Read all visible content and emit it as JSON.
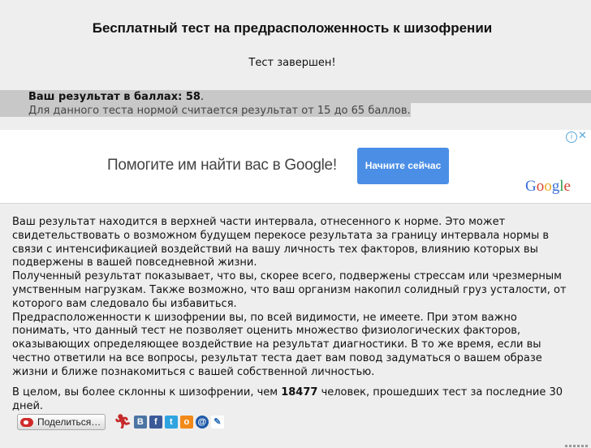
{
  "header": {
    "title": "Бесплатный тест на предрасположенность к шизофрении",
    "status": "Тест завершен!"
  },
  "result": {
    "label": "Ваш результат в баллах:",
    "score": "58",
    "norm_text": "Для данного теста нормой считается результат от 15 до 65 баллов."
  },
  "ad": {
    "text": "Помогите им найти вас в Google!",
    "button_label": "Начните сейчас",
    "logo": [
      "G",
      "o",
      "o",
      "g",
      "l",
      "e"
    ],
    "choices_icon": "i",
    "close_icon": "✕"
  },
  "description": {
    "p1": "Ваш результат находится в верхней части интервала, отнесенного к норме. Это может свидетельствовать о возможном будущем перекосе результата за границу интервала нормы в связи с интенсификацией воздействий на вашу личность тех факторов, влиянию которых вы подвержены в вашей повседневной жизни.",
    "p2": "Полученный результат показывает, что вы, скорее всего, подвержены стрессам или чрезмерным умственным нагрузкам. Также возможно, что ваш организм накопил солидный груз усталости, от которого вам следовало бы избавиться.",
    "p3": "Предрасположенности к шизофрении вы, по всей видимости, не имеете. При этом важно понимать, что данный тест не позволяет оценить множество физиологических факторов, оказывающих определяющее воздействие на результат диагностики. В то же время, если вы честно ответили на все вопросы, результат теста дает вам повод задуматься о вашем образе жизни и ближе познакомиться с вашей собственной личностью."
  },
  "summary": {
    "before": "В целом, вы более склонны к шизофрении, чем ",
    "count": "18477",
    "after": " человек, прошедших тест за последние 30 дней."
  },
  "share": {
    "button_label": "Поделиться…",
    "icons": {
      "vk": "В",
      "fb": "f",
      "tw": "t",
      "ok": "о",
      "mail": "@",
      "lj": "✎",
      "runner": "𐀪"
    }
  }
}
